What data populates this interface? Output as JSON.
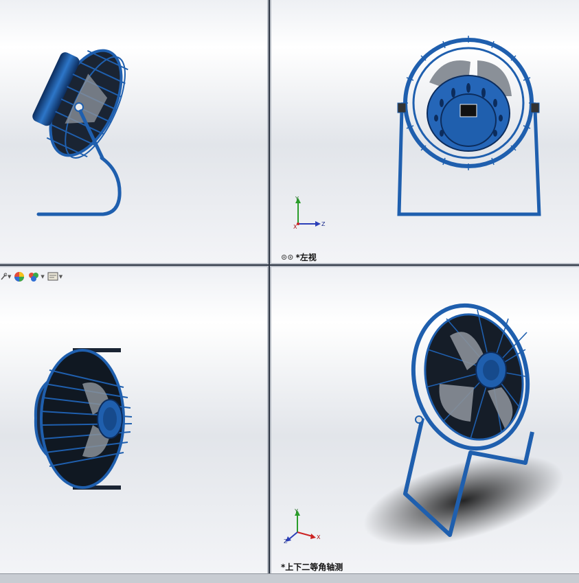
{
  "views": {
    "top_left": {
      "label": ""
    },
    "top_right": {
      "label": "*左视"
    },
    "bottom_left": {
      "label": ""
    },
    "bottom_right": {
      "label": "*上下二等角轴测"
    }
  },
  "triad": {
    "top_right": {
      "y": "Y",
      "z": "Z",
      "x": "X"
    },
    "bottom_right": {
      "y": "Y",
      "z": "Z",
      "x": "X"
    }
  },
  "toolbar": {
    "buttons": [
      {
        "icon": "view-setting-icon"
      },
      {
        "icon": "appearance-icon"
      },
      {
        "icon": "scene-icon"
      },
      {
        "icon": "display-settings-icon"
      }
    ]
  },
  "colors": {
    "model_blue": "#1f5fae",
    "model_dark": "#0c2c5c",
    "blade_grey": "#8a9098",
    "divider": "#2c3442"
  }
}
